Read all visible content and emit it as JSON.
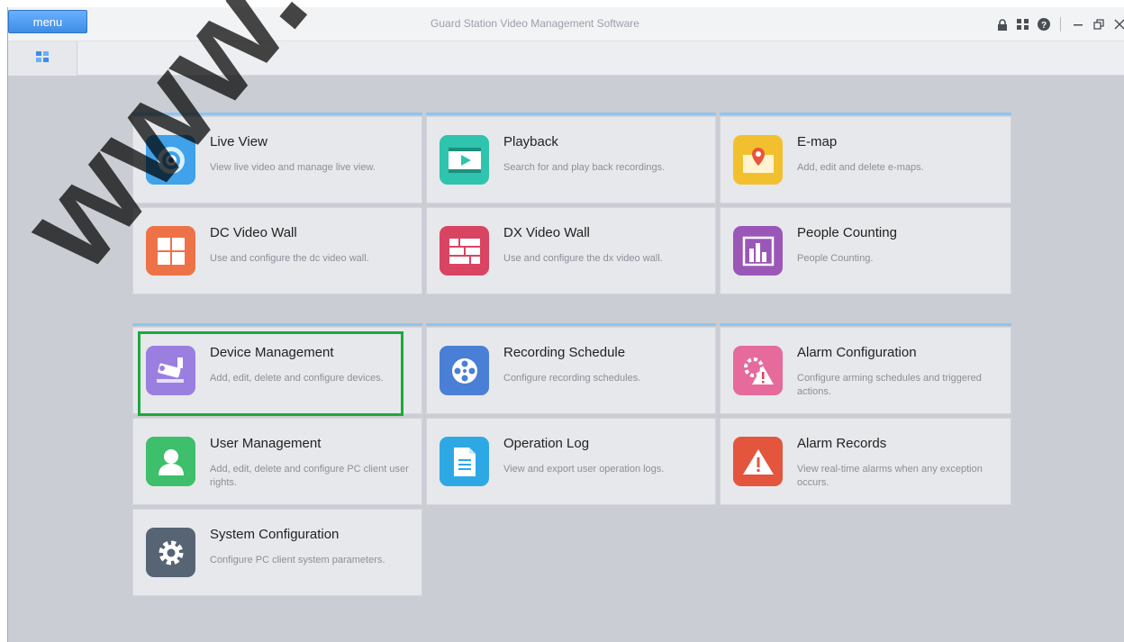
{
  "window": {
    "menu_label": "menu",
    "title": "Guard Station Video Management Software"
  },
  "titlebar_icons": [
    "lock-icon",
    "layout-icon",
    "help-icon",
    "minimize-icon",
    "restore-icon",
    "close-icon"
  ],
  "tabbar": {
    "home_tab_icon": "grid-icon"
  },
  "tiles": [
    {
      "title": "Live View",
      "desc": "View live video and manage live view.",
      "icon": "camera-lens-icon",
      "color": "#3fa2ea"
    },
    {
      "title": "Playback",
      "desc": "Search for and play back recordings.",
      "icon": "film-play-icon",
      "color": "#2ec4ad"
    },
    {
      "title": "E-map",
      "desc": "Add, edit and delete e-maps.",
      "icon": "map-pin-icon",
      "color": "#f2c02f"
    },
    {
      "title": "DC Video Wall",
      "desc": "Use and configure the dc video wall.",
      "icon": "windows-grid-icon",
      "color": "#ee7248"
    },
    {
      "title": "DX Video Wall",
      "desc": "Use and configure the dx video wall.",
      "icon": "video-wall-icon",
      "color": "#d94462"
    },
    {
      "title": "People Counting",
      "desc": "People Counting.",
      "icon": "bar-chart-icon",
      "color": "#9a57b8"
    },
    {
      "title": "Device Management",
      "desc": "Add, edit, delete and configure devices.",
      "icon": "cctv-camera-icon",
      "color": "#9a7fe0"
    },
    {
      "title": "Recording Schedule",
      "desc": "Configure recording schedules.",
      "icon": "film-reel-icon",
      "color": "#4a7fd6"
    },
    {
      "title": "Alarm Configuration",
      "desc": "Configure arming schedules and triggered actions.",
      "icon": "alarm-gear-icon",
      "color": "#e66a9c"
    },
    {
      "title": "User Management",
      "desc": "Add, edit, delete and configure PC client user rights.",
      "icon": "user-icon",
      "color": "#3dbf6c"
    },
    {
      "title": "Operation Log",
      "desc": "View and export user operation logs.",
      "icon": "document-icon",
      "color": "#2ea8e5"
    },
    {
      "title": "Alarm Records",
      "desc": "View real-time alarms when any exception occurs.",
      "icon": "warning-icon",
      "color": "#e3553d"
    },
    {
      "title": "System Configuration",
      "desc": "Configure PC client system parameters.",
      "icon": "settings-gear-icon",
      "color": "#566474"
    }
  ],
  "watermark": "www.atis-s"
}
